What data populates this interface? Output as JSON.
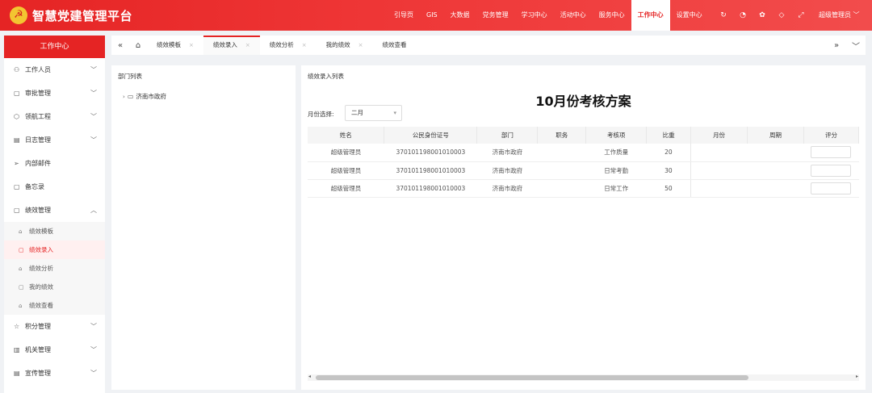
{
  "header": {
    "logo_glyph": "☭",
    "title": "智慧党建管理平台",
    "nav": [
      "引导页",
      "GIS",
      "大数据",
      "党务管理",
      "学习中心",
      "活动中心",
      "服务中心",
      "工作中心",
      "设置中心"
    ],
    "active_nav": "工作中心",
    "icons": [
      "refresh-icon",
      "chat-icon",
      "palette-icon",
      "tag-icon",
      "fullscreen-icon"
    ],
    "icon_glyphs": [
      "↻",
      "◔",
      "✿",
      "◇",
      "⤢"
    ],
    "user": "超级管理员 ﹀"
  },
  "sidebar": {
    "title": "工作中心",
    "items": [
      {
        "label": "工作人员",
        "icon": "⚇",
        "chev": "﹀"
      },
      {
        "label": "审批管理",
        "icon": "▢",
        "chev": "﹀"
      },
      {
        "label": "领航工程",
        "icon": "⬡",
        "chev": "﹀"
      },
      {
        "label": "日志管理",
        "icon": "▤",
        "chev": "﹀"
      },
      {
        "label": "内部邮件",
        "icon": "➢",
        "chev": ""
      },
      {
        "label": "备忘录",
        "icon": "▢",
        "chev": ""
      },
      {
        "label": "绩效管理",
        "icon": "▢",
        "chev": "︿"
      }
    ],
    "sub_items": [
      {
        "label": "绩效模板",
        "icon": "⌂"
      },
      {
        "label": "绩效录入",
        "icon": "▢"
      },
      {
        "label": "绩效分析",
        "icon": "⌂"
      },
      {
        "label": "我的绩效",
        "icon": "▢"
      },
      {
        "label": "绩效查看",
        "icon": "⌂"
      }
    ],
    "active_sub": "绩效录入",
    "bottom_items": [
      {
        "label": "积分管理",
        "icon": "☆",
        "chev": "﹀"
      },
      {
        "label": "机关管理",
        "icon": "▥",
        "chev": "﹀"
      },
      {
        "label": "宣传管理",
        "icon": "▤",
        "chev": "﹀"
      }
    ]
  },
  "tabs": {
    "back": "«",
    "home": "⌂",
    "items": [
      "绩效模板",
      "绩效录入",
      "绩效分析",
      "我的绩效",
      "绩效查看"
    ],
    "active": "绩效录入",
    "close": "×",
    "forward": "»",
    "more": "﹀"
  },
  "left_panel": {
    "title": "部门列表",
    "tree": [
      {
        "arrow": "›",
        "folder": "▭",
        "label": "济南市政府"
      }
    ]
  },
  "right_panel": {
    "title": "绩效录入列表",
    "scheme_title": "10月份考核方案",
    "month_label": "月份选择:",
    "month_value": "二月",
    "month_caret": "▾",
    "columns": [
      "姓名",
      "公民身份证号",
      "部门",
      "职务",
      "考核项",
      "比重",
      "月份",
      "周期",
      "评分"
    ],
    "rows": [
      {
        "name": "超级管理员",
        "id": "370101198001010003",
        "dept": "济南市政府",
        "position": "",
        "item": "工作质量",
        "weight": "20",
        "month": "",
        "period": ""
      },
      {
        "name": "超级管理员",
        "id": "370101198001010003",
        "dept": "济南市政府",
        "position": "",
        "item": "日常考勤",
        "weight": "30",
        "month": "",
        "period": ""
      },
      {
        "name": "超级管理员",
        "id": "370101198001010003",
        "dept": "济南市政府",
        "position": "",
        "item": "日常工作",
        "weight": "50",
        "month": "",
        "period": ""
      }
    ],
    "scroll_left": "◂",
    "scroll_right": "▸"
  },
  "colors": {
    "accent": "#e52424"
  }
}
